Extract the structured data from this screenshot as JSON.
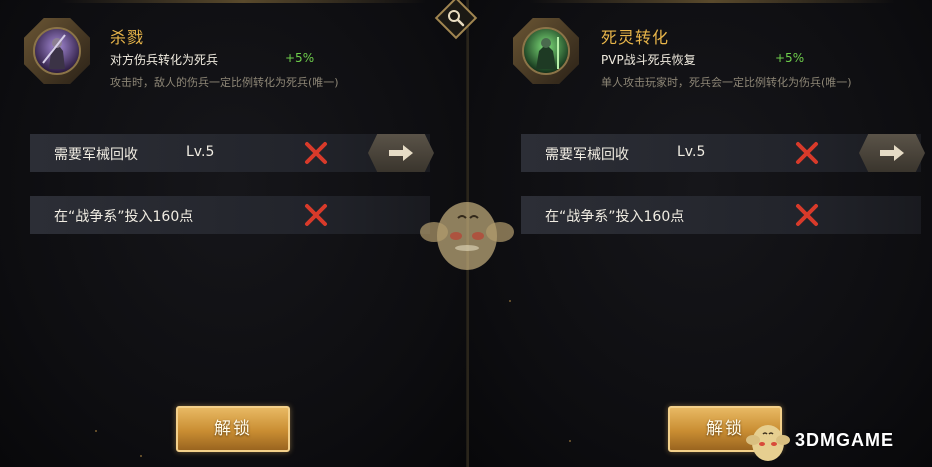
{
  "left_panel": {
    "skill_name": "杀戮",
    "effect": "对方伤兵转化为死兵",
    "bonus": "+5%",
    "description": "攻击时，敌人的伤兵一定比例转化为死兵(唯一)",
    "requirements": [
      {
        "label": "需要军械回收",
        "level": "Lv.5",
        "met": false,
        "has_goto": true
      },
      {
        "label": "在“战争系”投入160点",
        "level": "",
        "met": false,
        "has_goto": false
      }
    ],
    "unlock_label": "解锁"
  },
  "right_panel": {
    "skill_name": "死灵转化",
    "effect": "PVP战斗死兵恢复",
    "bonus": "+5%",
    "description": "单人攻击玩家时，死兵会一定比例转化为伤兵(唯一)",
    "requirements": [
      {
        "label": "需要军械回收",
        "level": "Lv.5",
        "met": false,
        "has_goto": true
      },
      {
        "label": "在“战争系”投入160点",
        "level": "",
        "met": false,
        "has_goto": false
      }
    ],
    "unlock_label": "解锁"
  },
  "watermark": "3DMGAME",
  "icons": {
    "search": "search-icon",
    "not_met": "red-x-icon",
    "goto": "arrow-right-icon"
  },
  "colors": {
    "skill_name": "#e9b64a",
    "bonus": "#6fcf4c",
    "fail": "#d83a2a",
    "button_gold": "#c98d32"
  }
}
